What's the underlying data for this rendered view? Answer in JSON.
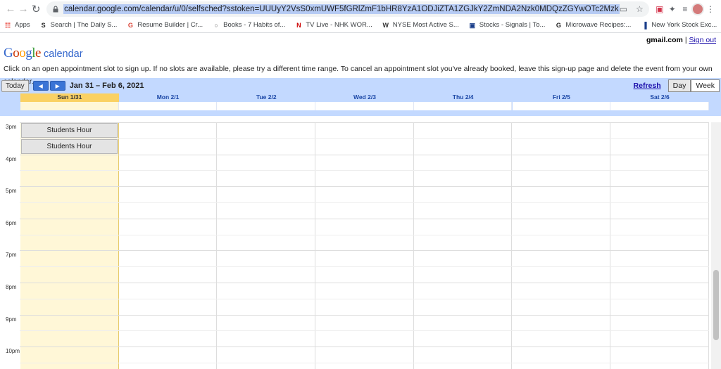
{
  "browser": {
    "url": "calendar.google.com/calendar/u/0/selfsched?sstoken=UUUyY2VsS0xmUWF5fGRlZmF1bHR8YzA1ODJiZTA1ZGJkY2ZmNDA2Nzk0MDQzZGYwOTc2Mzk",
    "bookmarks": [
      {
        "icon": "apps-grid-icon",
        "label": "Apps"
      },
      {
        "icon": "daily-stoic-icon",
        "label": "Search | The Daily S..."
      },
      {
        "icon": "google-g-icon",
        "label": "Resume Builder | Cr..."
      },
      {
        "icon": "book-icon",
        "label": "Books - 7 Habits of..."
      },
      {
        "icon": "nhk-icon",
        "label": "TV Live - NHK WOR..."
      },
      {
        "icon": "wsj-icon",
        "label": "NYSE Most Active S..."
      },
      {
        "icon": "stocks-icon",
        "label": "Stocks - Signals | To..."
      },
      {
        "icon": "recipe-icon",
        "label": "Microwave Recipes:..."
      },
      {
        "icon": "bars-icon",
        "label": "New York Stock Exc..."
      }
    ],
    "more_label": "»"
  },
  "page": {
    "email": "gmail.com",
    "sign_out": "Sign out",
    "logo_google": "Google",
    "logo_calendar": "calendar",
    "instructions": "Click on an open appointment slot to sign up. If no slots are available, please try a different time range. To cancel an appointment slot you've already booked, leave this sign-up page and delete the event from your own calendar."
  },
  "toolbar": {
    "today": "Today",
    "prev": "◀",
    "next": "▶",
    "date_range": "Jan 31 – Feb 6, 2021",
    "refresh": "Refresh",
    "day": "Day",
    "week": "Week"
  },
  "days": [
    "Sun 1/31",
    "Mon 2/1",
    "Tue 2/2",
    "Wed 2/3",
    "Thu 2/4",
    "Fri 2/5",
    "Sat 2/6"
  ],
  "hours": [
    "3pm",
    "4pm",
    "5pm",
    "6pm",
    "7pm",
    "8pm",
    "9pm",
    "10pm"
  ],
  "slots": [
    {
      "label": "Students Hour"
    },
    {
      "label": "Students Hour"
    }
  ],
  "colors": {
    "toolbar_bg": "#c3d9ff",
    "today_header": "#fad163",
    "today_col": "#fff7d7",
    "link": "#1a0dab"
  }
}
